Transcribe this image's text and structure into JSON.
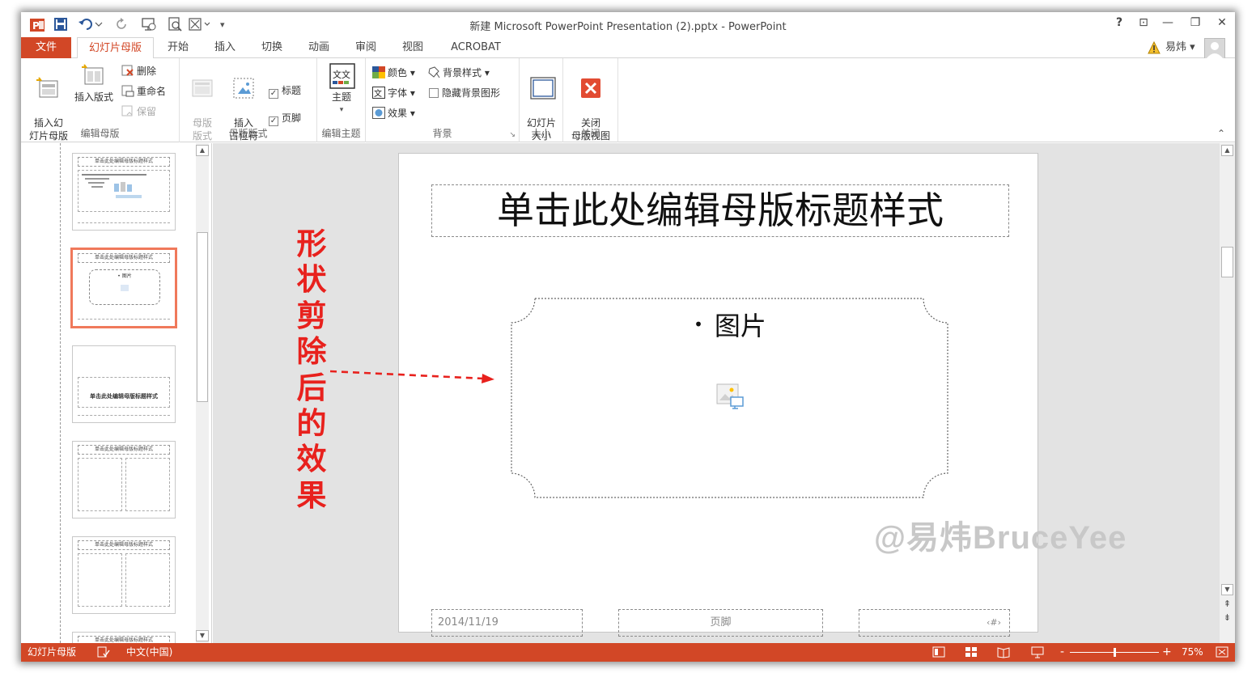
{
  "titlebar": {
    "document_title": "新建 Microsoft PowerPoint Presentation (2).pptx - PowerPoint",
    "help": "?",
    "qat_dropdown": "▾",
    "window_controls": {
      "restore_ribbon": "⊡",
      "minimize": "—",
      "maximize": "❐",
      "close": "✕"
    }
  },
  "tabs": [
    {
      "label": "文件"
    },
    {
      "label": "幻灯片母版"
    },
    {
      "label": "开始"
    },
    {
      "label": "插入"
    },
    {
      "label": "切换"
    },
    {
      "label": "动画"
    },
    {
      "label": "审阅"
    },
    {
      "label": "视图"
    },
    {
      "label": "ACROBAT"
    }
  ],
  "user": {
    "name": "易炜",
    "warning_icon": "warning-icon"
  },
  "ribbon": {
    "edit_master": {
      "label": "编辑母版",
      "insert_slide_master": "插入幻\n灯片母版",
      "insert_layout": "插入版式",
      "delete": "删除",
      "rename": "重命名",
      "preserve": "保留"
    },
    "master_layout": {
      "label": "母版版式",
      "master_layout_btn": "母版\n版式",
      "insert_placeholder": "插入\n占位符",
      "title_check": "标题",
      "footer_check": "页脚"
    },
    "edit_theme": {
      "label": "编辑主题",
      "themes": "主题"
    },
    "background": {
      "label": "背景",
      "colors": "颜色",
      "fonts": "字体",
      "effects": "效果",
      "background_styles": "背景样式",
      "hide_bg_graphics": "隐藏背景图形"
    },
    "size": {
      "label": "大小",
      "slide_size": "幻灯片\n大小"
    },
    "close": {
      "label": "关闭",
      "close_master_view": "关闭\n母版视图"
    }
  },
  "thumbnails": [
    {
      "title": "单击此处编辑母版标题样式"
    },
    {
      "title": "单击此处编辑母版标题样式",
      "body": "• 图片"
    },
    {
      "title": "单击此处编辑母版标题样式"
    },
    {
      "title": "单击此处编辑母版标题样式"
    },
    {
      "title": "单击此处编辑母版标题样式"
    },
    {
      "title": "单击此处编辑母版标题样式"
    }
  ],
  "slide": {
    "title": "单击此处编辑母版标题样式",
    "bullet": "图片",
    "date": "2014/11/19",
    "footer": "页脚",
    "slide_number": "‹#›"
  },
  "annotation": {
    "text": "形状剪除后的效果"
  },
  "watermark": "@易炜BruceYee",
  "statusbar": {
    "view_name": "幻灯片母版",
    "language": "中文(中国)",
    "zoom_minus": "-",
    "zoom_plus": "+",
    "zoom": "75%",
    "zoom_fraction": 0.5
  },
  "colors": {
    "accent": "#d24726",
    "selection": "#f0795b",
    "annotation": "#e8211d"
  }
}
